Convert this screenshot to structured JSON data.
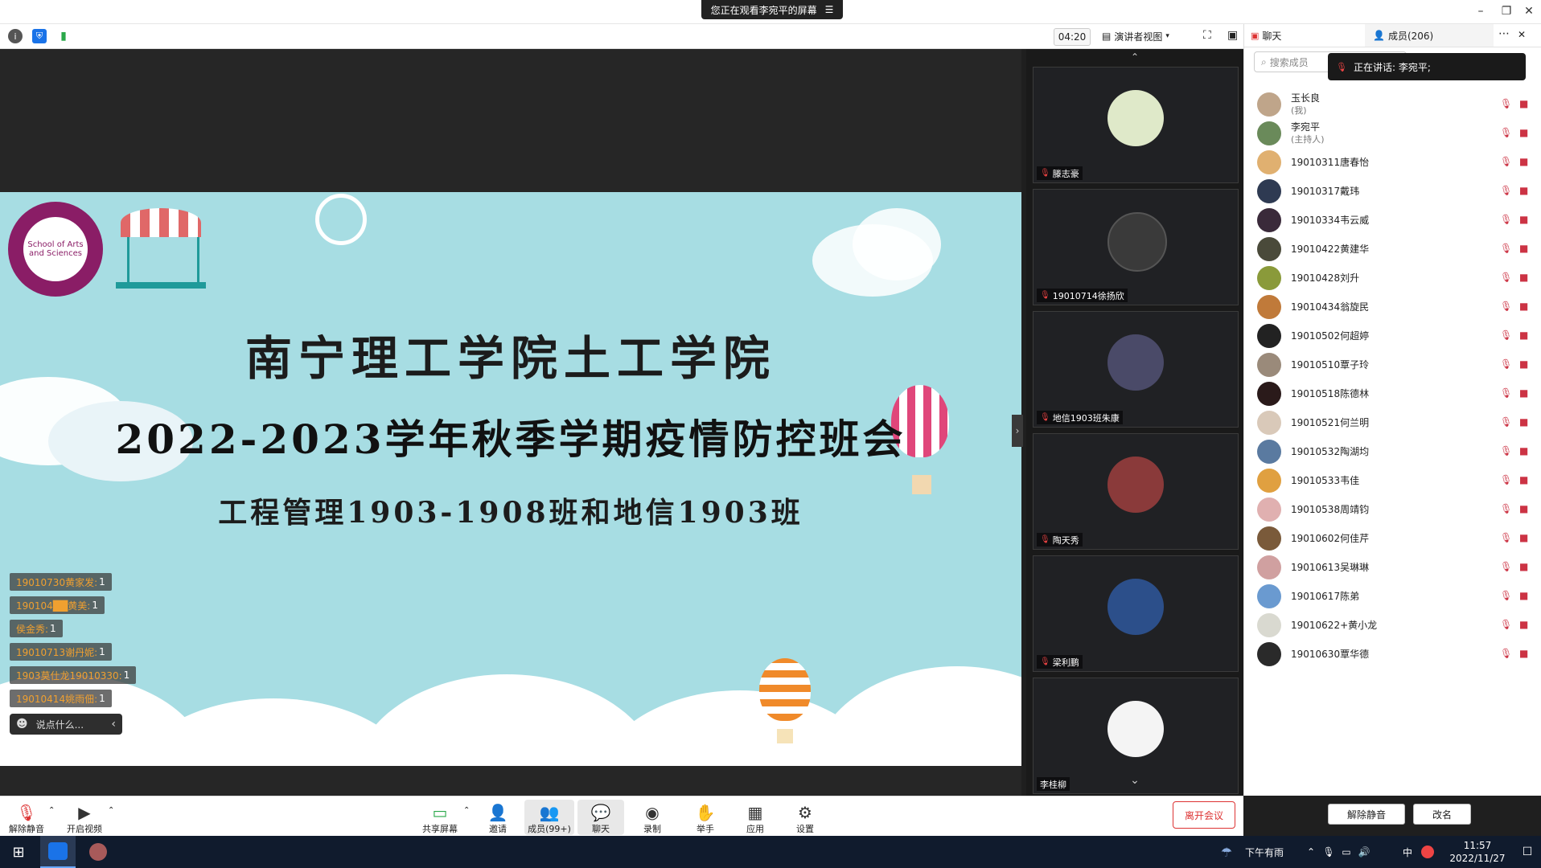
{
  "window": {
    "share_banner": "您正在观看李宛平的屏幕",
    "banner_menu_icon": "☰",
    "minimize_icon": "–",
    "restore_icon": "❐",
    "close_icon": "✕"
  },
  "toolbar": {
    "timer": "04:20",
    "view_mode": "演讲者视图",
    "info_icon": "i",
    "shield_icon": "⛨",
    "signal_icon": "▮",
    "fullscreen_icon": "⛶",
    "layout_icon": "▣"
  },
  "slide": {
    "title": "南宁理工学院土工学院",
    "subtitle": "2022-2023学年秋季学期疫情防控班会",
    "classes": "工程管理1903-1908班和地信1903班",
    "logo_text": "School of Arts and Sciences"
  },
  "chat_messages": [
    {
      "name": "19010730黄家发:",
      "count": "1"
    },
    {
      "name": "190104██黄美:",
      "count": "1"
    },
    {
      "name": "侯金秀:",
      "count": "1"
    },
    {
      "name": "19010713谢丹妮:",
      "count": "1"
    },
    {
      "name": "1903莫仕龙19010330:",
      "count": "1"
    },
    {
      "name": "19010414姚雨佃:",
      "count": "1"
    }
  ],
  "chat_input": {
    "placeholder": "说点什么...",
    "emoji_icon": "☻",
    "collapse_icon": "‹"
  },
  "video_tiles": [
    {
      "name": "滕志豪",
      "color": "#dfe9c9"
    },
    {
      "name": "19010714徐扬欣",
      "color": "#3a3a3a"
    },
    {
      "name": "地信1903班朱康",
      "color": "#4a4a68"
    },
    {
      "name": "陶天秀",
      "color": "#8a3a3a"
    },
    {
      "name": "梁利鹏",
      "color": "#2c4f8a"
    },
    {
      "name": "李桂柳",
      "color": "#f4f4f4"
    }
  ],
  "strip": {
    "up_icon": "⌃",
    "down_icon": "⌄",
    "expand_icon": "›"
  },
  "panel": {
    "tab_chat": "聊天",
    "tab_members": "成员(206)",
    "more_icon": "⋯",
    "close_icon": "✕",
    "search_placeholder": "搜索成员",
    "speaking": "正在讲话: 李宛平;",
    "unmute_all": "解除静音",
    "rename": "改名"
  },
  "members": [
    {
      "name": "玉长良",
      "role": "(我)",
      "color": "#bfa58a"
    },
    {
      "name": "李宛平",
      "role": "(主持人)",
      "color": "#6a8a5a"
    },
    {
      "name": "19010311唐春怡",
      "role": "",
      "color": "#e0b070"
    },
    {
      "name": "19010317戴玮",
      "role": "",
      "color": "#2e3a52"
    },
    {
      "name": "19010334韦云威",
      "role": "",
      "color": "#3a2a3a"
    },
    {
      "name": "19010422黄建华",
      "role": "",
      "color": "#4a4a3a"
    },
    {
      "name": "19010428刘升",
      "role": "",
      "color": "#8a9a3a"
    },
    {
      "name": "19010434翁旋民",
      "role": "",
      "color": "#c07a3a"
    },
    {
      "name": "19010502何超婷",
      "role": "",
      "color": "#222222"
    },
    {
      "name": "19010510覃子玲",
      "role": "",
      "color": "#9a8a7a"
    },
    {
      "name": "19010518陈德林",
      "role": "",
      "color": "#2a1a1a"
    },
    {
      "name": "19010521何兰明",
      "role": "",
      "color": "#d9c9b9"
    },
    {
      "name": "19010532陶湖均",
      "role": "",
      "color": "#5a7aa0"
    },
    {
      "name": "19010533韦佳",
      "role": "",
      "color": "#e0a040"
    },
    {
      "name": "19010538周靖钧",
      "role": "",
      "color": "#e0b0b0"
    },
    {
      "name": "19010602何佳芹",
      "role": "",
      "color": "#7a5a3a"
    },
    {
      "name": "19010613吴琳琳",
      "role": "",
      "color": "#d0a0a0"
    },
    {
      "name": "19010617陈弟",
      "role": "",
      "color": "#6a9ad0"
    },
    {
      "name": "19010622+黄小龙",
      "role": "",
      "color": "#d9d9d0"
    },
    {
      "name": "19010630覃华德",
      "role": "",
      "color": "#2a2a2a"
    }
  ],
  "controls": {
    "unmute": "解除静音",
    "start_video": "开启视频",
    "share_screen": "共享屏幕",
    "invite": "邀请",
    "members": "成员(99+)",
    "chat": "聊天",
    "record": "录制",
    "raise_hand": "举手",
    "apps": "应用",
    "settings": "设置",
    "leave": "离开会议"
  },
  "taskbar": {
    "weather": "下午有雨",
    "ime": "中",
    "time": "11:57",
    "date": "2022/11/27",
    "start_icon": "⊞",
    "notification_icon": "☐"
  },
  "colors": {
    "slide_bg": "#a7dde3",
    "leave_red": "#d33333",
    "accent_blue": "#1a73e8",
    "taskbar": "#101b2d"
  }
}
